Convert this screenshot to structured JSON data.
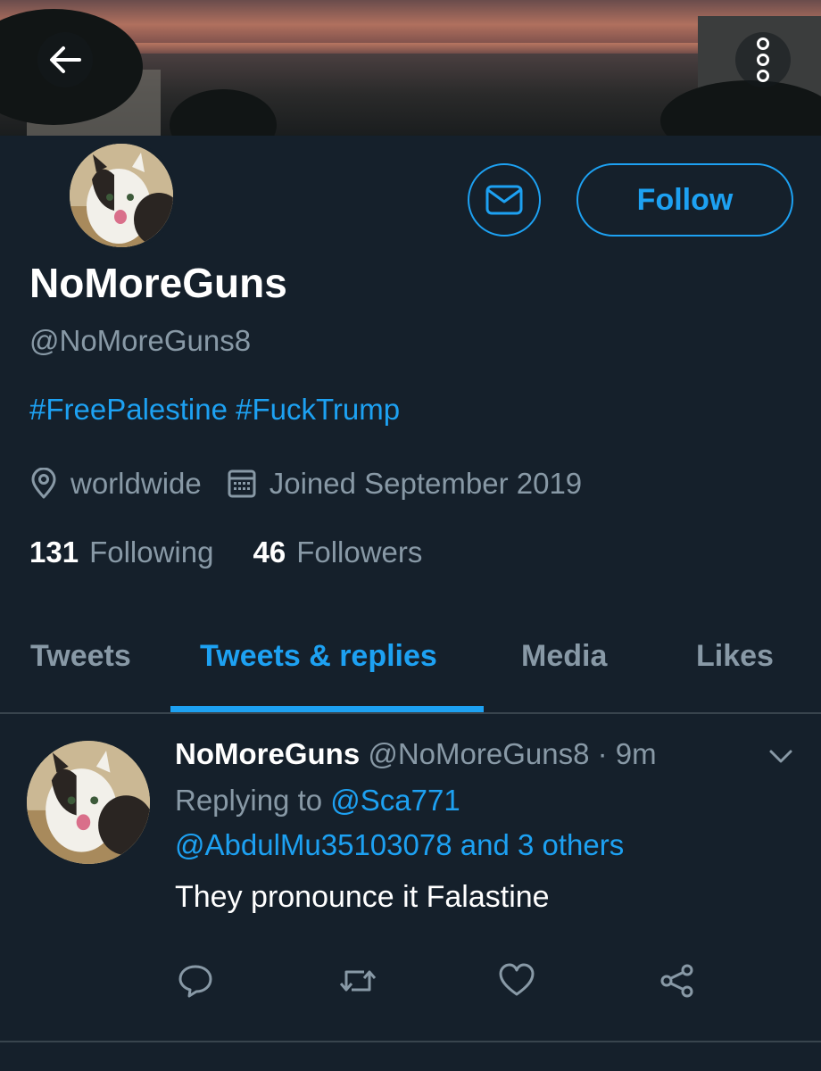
{
  "profile": {
    "display_name": "NoMoreGuns",
    "handle": "@NoMoreGuns8",
    "bio": "#FreePalestine #FuckTrump",
    "location": "worldwide",
    "joined": "Joined September 2019",
    "following_count": "131",
    "following_label": "Following",
    "followers_count": "46",
    "followers_label": "Followers",
    "follow_label": "Follow"
  },
  "tabs": [
    {
      "label": "Tweets",
      "active": false
    },
    {
      "label": "Tweets & replies",
      "active": true
    },
    {
      "label": "Media",
      "active": false
    },
    {
      "label": "Likes",
      "active": false
    }
  ],
  "tweet": {
    "name": "NoMoreGuns",
    "handle": "@NoMoreGuns8",
    "sep": "·",
    "time": "9m",
    "replying_prefix": "Replying to",
    "replying_user": "@Sca771",
    "replying_line2": "@AbdulMu35103078 and 3 others",
    "text": "They pronounce it Falastine"
  },
  "icons": {
    "back": "back-arrow-icon",
    "more": "more-vertical-icon",
    "message": "envelope-icon",
    "location": "location-pin-icon",
    "calendar": "calendar-icon",
    "chevron": "chevron-down-icon",
    "reply": "reply-icon",
    "retweet": "retweet-icon",
    "like": "heart-icon",
    "share": "share-icon"
  },
  "colors": {
    "background": "#15202b",
    "accent": "#1da1f2",
    "muted": "#8899a6",
    "divider": "#38444d"
  }
}
